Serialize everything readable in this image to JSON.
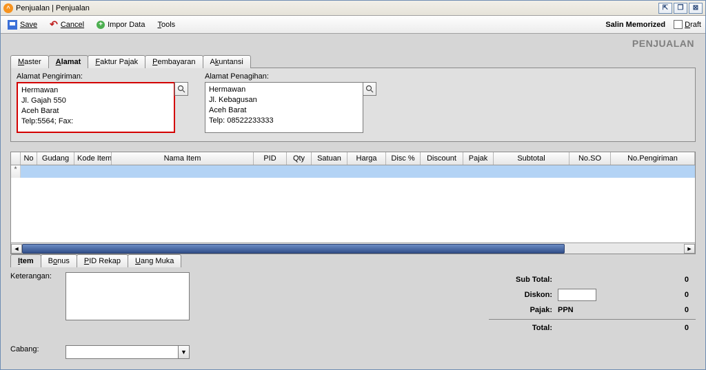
{
  "window": {
    "title": "Penjualan | Penjualan",
    "heading": "PENJUALAN"
  },
  "toolbar": {
    "save": "Save",
    "cancel": "Cancel",
    "impor": "Impor Data",
    "tools": "Tools",
    "salin": "Salin Memorized",
    "draft": "Draft"
  },
  "topTabs": [
    "Master",
    "Alamat",
    "Faktur Pajak",
    "Pembayaran",
    "Akuntansi"
  ],
  "topTabActive": 1,
  "address": {
    "shipLabel": "Alamat Pengiriman:",
    "billLabel": "Alamat Penagihan:",
    "ship": "Hermawan\nJl. Gajah 550\nAceh Barat\nTelp:5564; Fax:",
    "bill": "Hermawan\nJl. Kebagusan\nAceh Barat\nTelp: 08522233333"
  },
  "gridHeaders": [
    "No",
    "Gudang",
    "Kode Item",
    "Nama Item",
    "PID",
    "Qty",
    "Satuan",
    "Harga",
    "Disc %",
    "Discount",
    "Pajak",
    "Subtotal",
    "No.SO",
    "No.Pengiriman"
  ],
  "gridWidths": [
    24,
    54,
    54,
    206,
    48,
    36,
    52,
    56,
    50,
    62,
    44,
    110,
    60,
    78
  ],
  "bottomTabs": [
    "Item",
    "Bonus",
    "PID Rekap",
    "Uang Muka"
  ],
  "bottomTabActive": 0,
  "footer": {
    "ketLabel": "Keterangan:",
    "cabangLabel": "Cabang:"
  },
  "summary": {
    "subtotalLabel": "Sub Total:",
    "subtotal": "0",
    "diskonLabel": "Diskon:",
    "diskon": "0",
    "pajakLabel": "Pajak:",
    "pajakName": "PPN",
    "pajak": "0",
    "totalLabel": "Total:",
    "total": "0"
  }
}
